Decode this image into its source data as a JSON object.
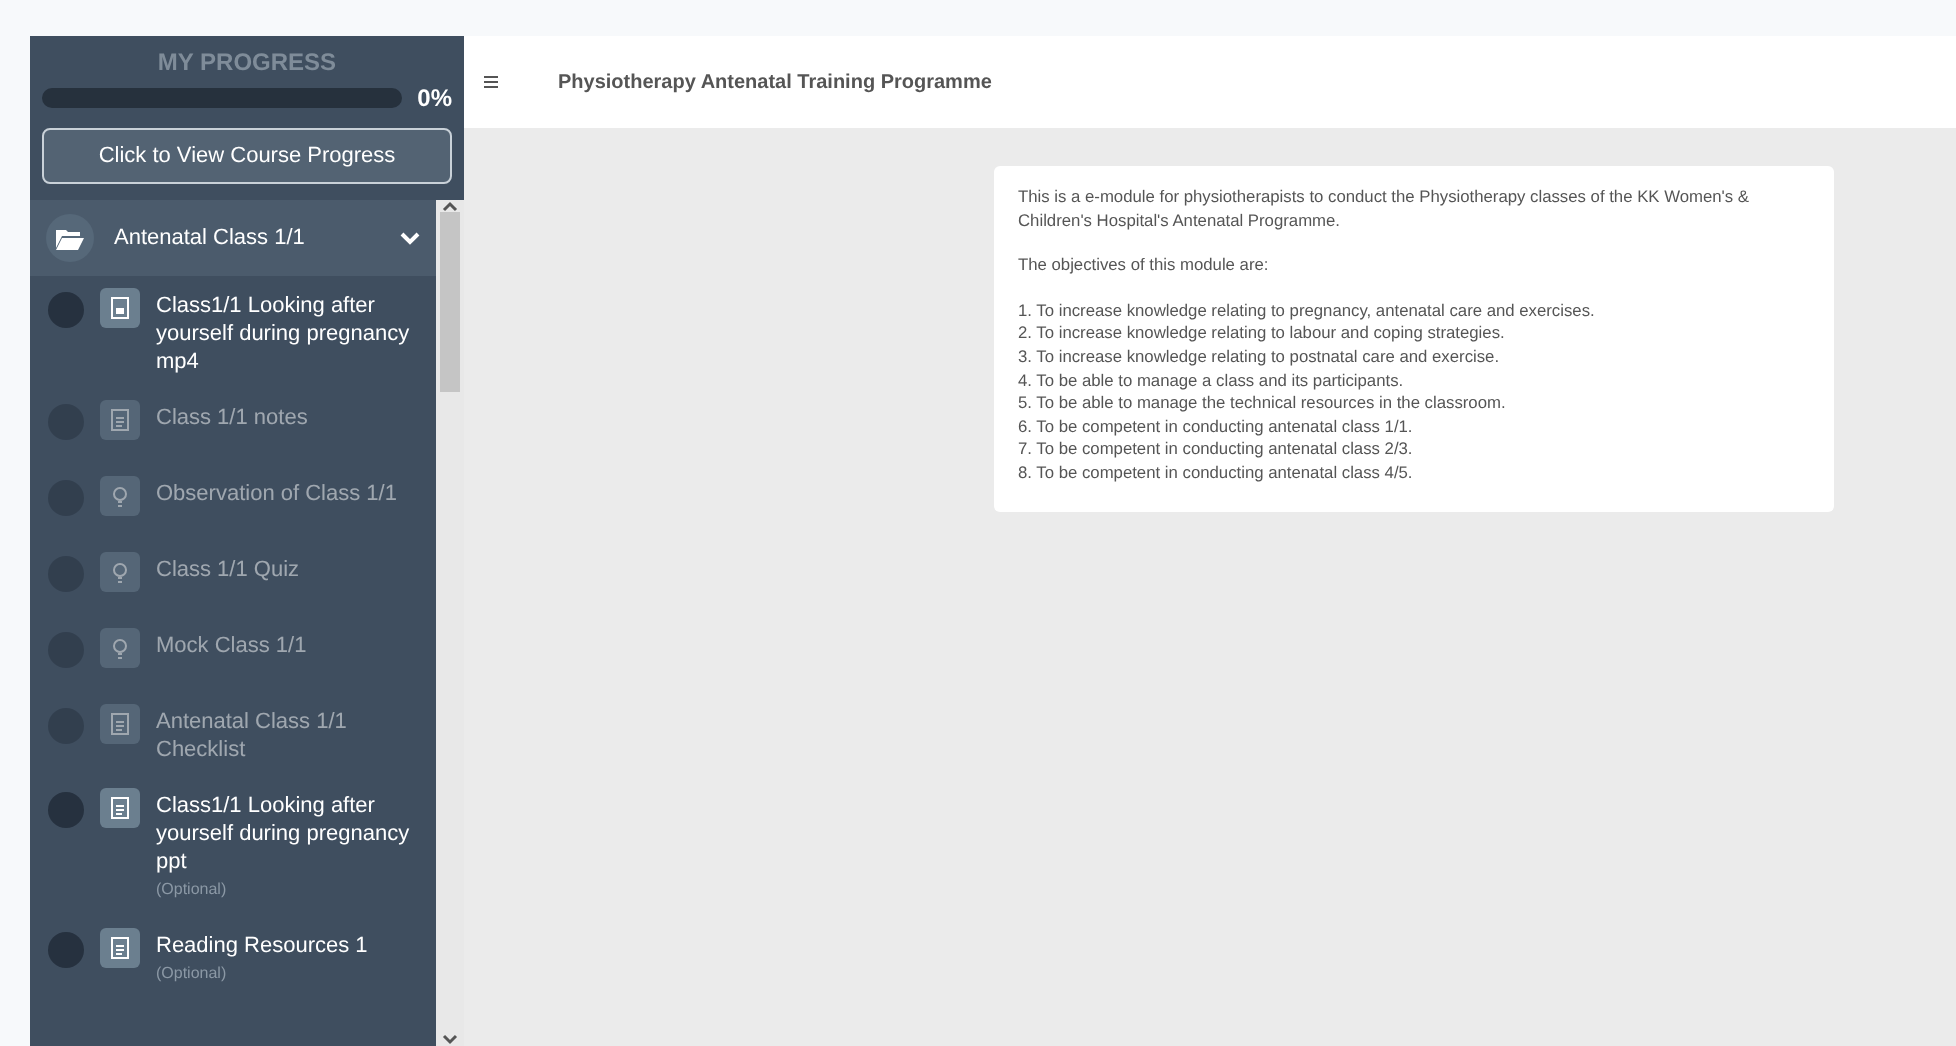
{
  "sidebar": {
    "progress_title": "MY PROGRESS",
    "progress": {
      "level": 0,
      "reading": "0%"
    },
    "course_progress_button": "Click to View Course Progress",
    "section": {
      "title": "Antenatal Class 1/1",
      "expanded": true
    },
    "items": [
      {
        "kind": "video",
        "title": "Class1/1 Looking after yourself during pregnancy mp4",
        "locked": false
      },
      {
        "kind": "doc",
        "title": "Class 1/1 notes",
        "locked": true
      },
      {
        "kind": "bulb",
        "title": "Observation of Class 1/1",
        "locked": true
      },
      {
        "kind": "bulb",
        "title": "Class 1/1 Quiz",
        "locked": true
      },
      {
        "kind": "bulb",
        "title": "Mock Class 1/1",
        "locked": true
      },
      {
        "kind": "doc",
        "title": "Antenatal Class 1/1 Checklist",
        "locked": true
      },
      {
        "kind": "doc",
        "title": "Class1/1 Looking after yourself during pregnancy ppt",
        "locked": false,
        "note": "(Optional)"
      },
      {
        "kind": "doc",
        "title": "Reading Resources 1",
        "locked": false,
        "note": "(Optional)"
      }
    ]
  },
  "header": {
    "title": "Physiotherapy Antenatal Training Programme"
  },
  "content": {
    "intro": "This is a e-module for physiotherapists to conduct the Physiotherapy classes of the KK Women's & Children's Hospital's Antenatal Programme.",
    "objectives_heading": "The objectives of this module are:",
    "objectives": [
      "1. To increase knowledge relating to pregnancy, antenatal care and exercises.",
      "2. To increase knowledge relating to labour and coping strategies.",
      "3. To increase knowledge relating to postnatal care and exercise.",
      "4. To be able to manage a class and its participants.",
      "5. To be able to manage the technical resources in the classroom.",
      "6. To be competent in conducting antenatal class 1/1.",
      "7. To be competent in conducting antenatal class 2/3.",
      "8. To be competent in conducting antenatal class 4/5."
    ]
  }
}
